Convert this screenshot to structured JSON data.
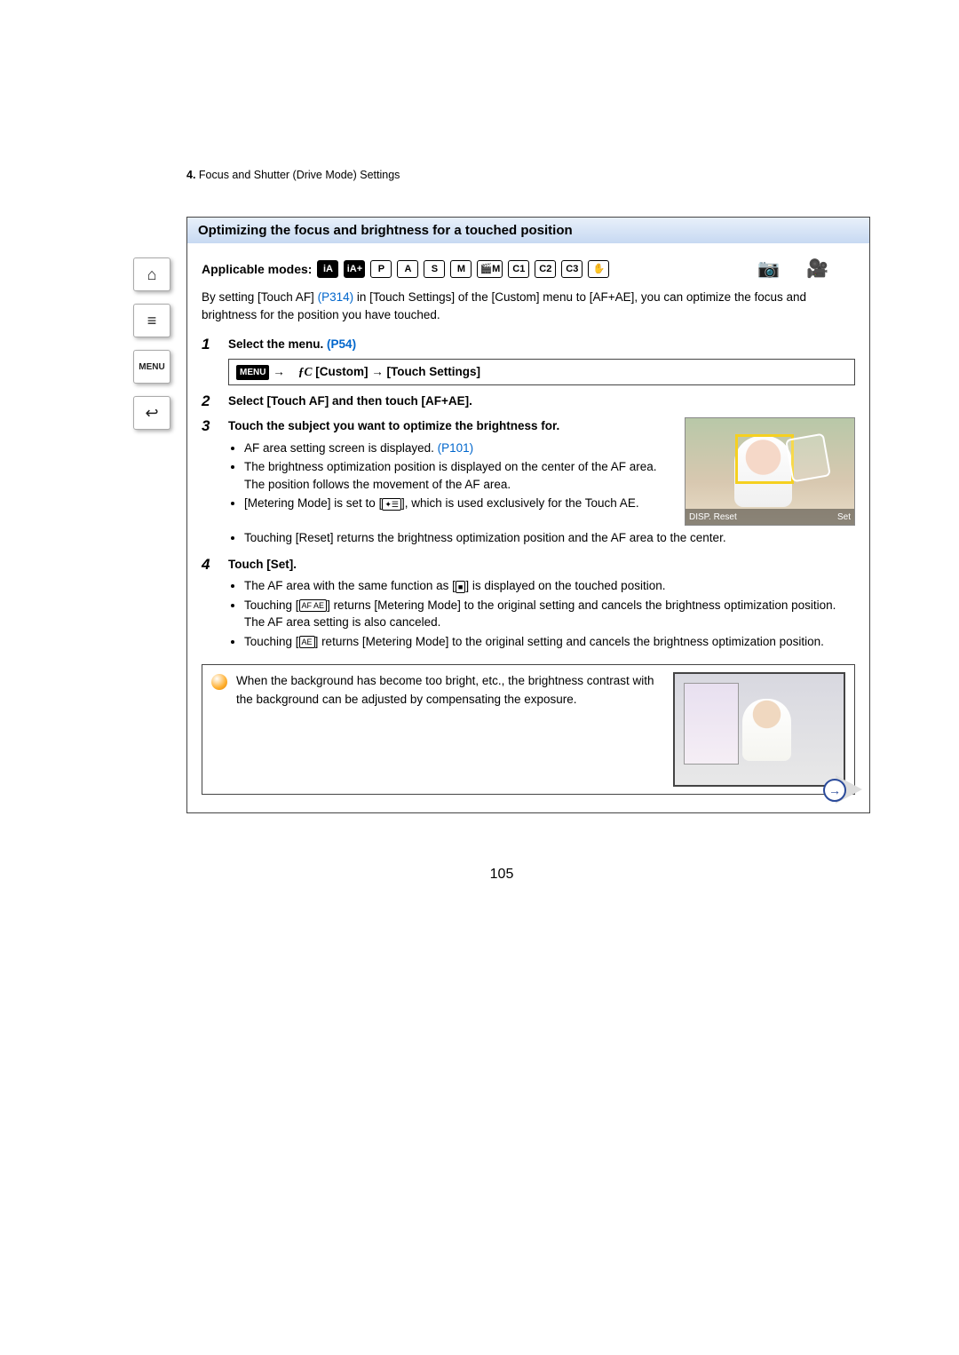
{
  "breadcrumb": {
    "num": "4.",
    "text": "Focus and Shutter (Drive Mode) Settings"
  },
  "sidebar": {
    "home": "⌂",
    "toc": "≡",
    "menu": "MENU",
    "back": "↩"
  },
  "section_heading": "Optimizing the focus and brightness for a touched position",
  "applicable": {
    "label": "Applicable modes:",
    "modes": [
      "iA",
      "iA+",
      "P",
      "A",
      "S",
      "M",
      "🎬M",
      "C1",
      "C2",
      "C3",
      "✋"
    ]
  },
  "intro": {
    "t1": "By setting [Touch AF] ",
    "link1": "(P314)",
    "t2": " in [Touch Settings] of the [Custom] menu to [AF+AE], you can optimize the focus and brightness for the position you have touched."
  },
  "steps": [
    {
      "num": "1",
      "title_a": "Select the menu. ",
      "title_link": "(P54)",
      "menu_chip": "MENU",
      "arrow": "→",
      "fc": "ƒC",
      "path_a": "[Custom]",
      "arrow2": "→",
      "path_b": "[Touch Settings]"
    },
    {
      "num": "2",
      "title": "Select [Touch AF] and then touch [AF+AE]."
    },
    {
      "num": "3",
      "title": "Touch the subject you want to optimize the brightness for.",
      "bullets": [
        {
          "t1": "AF area setting screen is displayed. ",
          "link": "(P101)"
        },
        {
          "t1": "The brightness optimization position is displayed on the center of the AF area. The position follows the movement of the AF area."
        },
        {
          "t1": "[Metering Mode] is set to [",
          "icon": "✦☰",
          "t2": "], which is used exclusively for the Touch AE."
        },
        {
          "t1": "Touching [Reset] returns the brightness optimization position and the AF area to the center."
        }
      ],
      "thumb": {
        "disp": "DISP.",
        "reset": "Reset",
        "set": "Set"
      }
    },
    {
      "num": "4",
      "title": "Touch [Set].",
      "bullets": [
        {
          "t1": "The AF area with the same function as [",
          "icon": "■",
          "t2": "] is displayed on the touched position."
        },
        {
          "t1": "Touching [",
          "icon": "AF AE",
          "t2": "] returns [Metering Mode] to the original setting and cancels the brightness optimization position. The AF area setting is also canceled."
        },
        {
          "t1": "Touching [",
          "icon": "AE",
          "t2": "] returns [Metering Mode] to the original setting and cancels the brightness optimization position."
        }
      ]
    }
  ],
  "tip": "When the background has become too bright, etc., the brightness contrast with the background can be adjusted by compensating the exposure.",
  "page_number": "105",
  "next_arrow": "→"
}
